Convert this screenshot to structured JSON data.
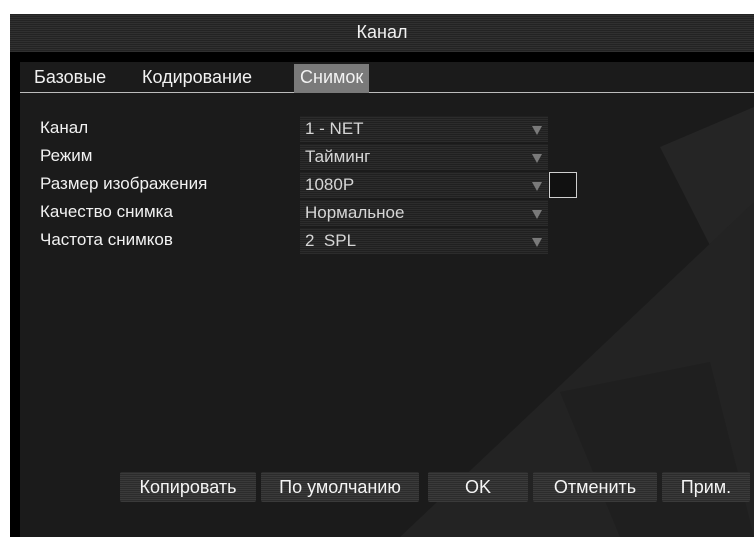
{
  "window": {
    "title": "Канал"
  },
  "tabs": [
    {
      "label": "Базовые"
    },
    {
      "label": "Кодирование"
    },
    {
      "label": "Снимок"
    }
  ],
  "active_tab": "Снимок",
  "fields": [
    {
      "label": "Канал",
      "value": "1 - NET"
    },
    {
      "label": "Режим",
      "value": "Тайминг",
      "checkbox_checked": false
    },
    {
      "label": "Размер изображения",
      "value": "1080P"
    },
    {
      "label": "Качество снимка",
      "value": "Нормальное"
    },
    {
      "label": "Частота снимков",
      "value": "2  SPL"
    }
  ],
  "buttons": {
    "copy": "Копировать",
    "default": "По умолчанию",
    "ok": "OK",
    "cancel": "Отменить",
    "apply": "Прим."
  },
  "icons": {
    "dropdown": "chevron-down-icon"
  },
  "colors": {
    "background": "#1b1b1b",
    "active_tab": "#7a7a7a",
    "text": "#f2f2f2"
  }
}
